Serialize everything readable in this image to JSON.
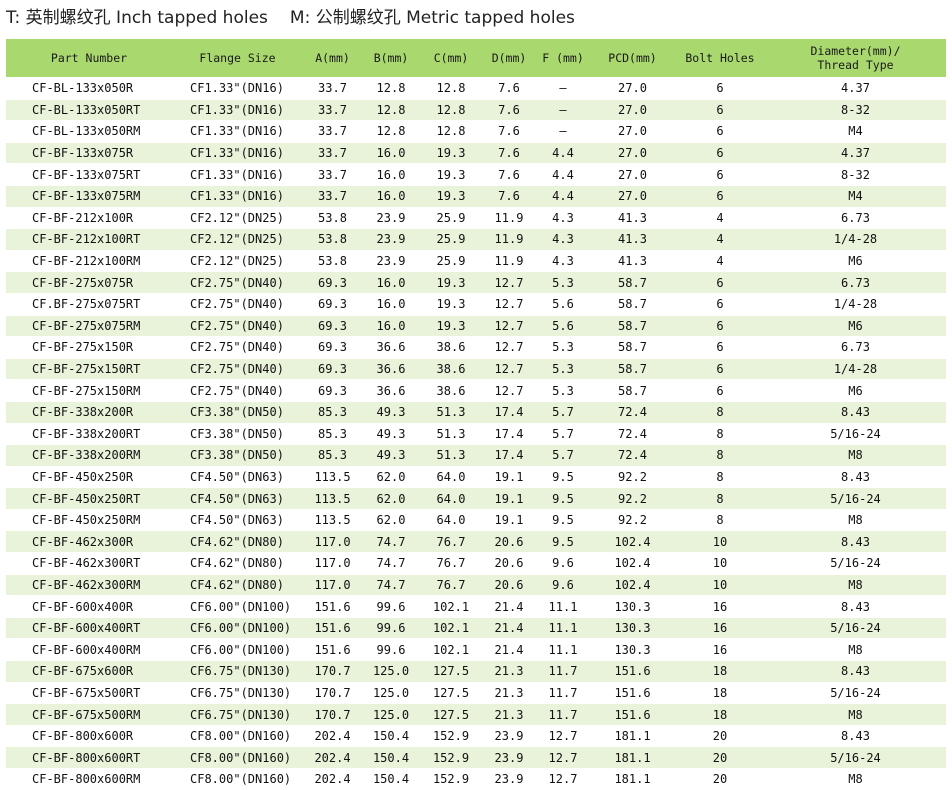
{
  "legend": {
    "inch": "T: 英制螺纹孔 Inch tapped holes",
    "metric": "M: 公制螺纹孔 Metric tapped holes"
  },
  "table": {
    "headers": [
      "Part Number",
      "Flange Size",
      "A(mm)",
      "B(mm)",
      "C(mm)",
      "D(mm)",
      "F (mm)",
      "PCD(mm)",
      "Bolt Holes",
      "Diameter(mm)/\nThread Type"
    ],
    "rows": [
      [
        "CF-BL-133x050R",
        "CF1.33\"(DN16)",
        "33.7",
        "12.8",
        "12.8",
        "7.6",
        "–",
        "27.0",
        "6",
        "4.37"
      ],
      [
        "CF-BL-133x050RT",
        "CF1.33\"(DN16)",
        "33.7",
        "12.8",
        "12.8",
        "7.6",
        "–",
        "27.0",
        "6",
        "8-32"
      ],
      [
        "CF-BL-133x050RM",
        "CF1.33\"(DN16)",
        "33.7",
        "12.8",
        "12.8",
        "7.6",
        "–",
        "27.0",
        "6",
        "M4"
      ],
      [
        "CF-BF-133x075R",
        "CF1.33\"(DN16)",
        "33.7",
        "16.0",
        "19.3",
        "7.6",
        "4.4",
        "27.0",
        "6",
        "4.37"
      ],
      [
        "CF-BF-133x075RT",
        "CF1.33\"(DN16)",
        "33.7",
        "16.0",
        "19.3",
        "7.6",
        "4.4",
        "27.0",
        "6",
        "8-32"
      ],
      [
        "CF-BF-133x075RM",
        "CF1.33\"(DN16)",
        "33.7",
        "16.0",
        "19.3",
        "7.6",
        "4.4",
        "27.0",
        "6",
        "M4"
      ],
      [
        "CF-BF-212x100R",
        "CF2.12\"(DN25)",
        "53.8",
        "23.9",
        "25.9",
        "11.9",
        "4.3",
        "41.3",
        "4",
        "6.73"
      ],
      [
        "CF-BF-212x100RT",
        "CF2.12\"(DN25)",
        "53.8",
        "23.9",
        "25.9",
        "11.9",
        "4.3",
        "41.3",
        "4",
        "1/4-28"
      ],
      [
        "CF-BF-212x100RM",
        "CF2.12\"(DN25)",
        "53.8",
        "23.9",
        "25.9",
        "11.9",
        "4.3",
        "41.3",
        "4",
        "M6"
      ],
      [
        "CF-BF-275x075R",
        "CF2.75\"(DN40)",
        "69.3",
        "16.0",
        "19.3",
        "12.7",
        "5.3",
        "58.7",
        "6",
        "6.73"
      ],
      [
        "CF.BF-275x075RT",
        "CF2.75\"(DN40)",
        "69.3",
        "16.0",
        "19.3",
        "12.7",
        "5.6",
        "58.7",
        "6",
        "1/4-28"
      ],
      [
        "CF-BF-275x075RM",
        "CF2.75\"(DN40)",
        "69.3",
        "16.0",
        "19.3",
        "12.7",
        "5.6",
        "58.7",
        "6",
        "M6"
      ],
      [
        "CF-BF-275x150R",
        "CF2.75\"(DN40)",
        "69.3",
        "36.6",
        "38.6",
        "12.7",
        "5.3",
        "58.7",
        "6",
        "6.73"
      ],
      [
        "CF-BF-275x150RT",
        "CF2.75\"(DN40)",
        "69.3",
        "36.6",
        "38.6",
        "12.7",
        "5.3",
        "58.7",
        "6",
        "1/4-28"
      ],
      [
        "CF-BF-275x150RM",
        "CF2.75\"(DN40)",
        "69.3",
        "36.6",
        "38.6",
        "12.7",
        "5.3",
        "58.7",
        "6",
        "M6"
      ],
      [
        "CF-BF-338x200R",
        "CF3.38\"(DN50)",
        "85.3",
        "49.3",
        "51.3",
        "17.4",
        "5.7",
        "72.4",
        "8",
        "8.43"
      ],
      [
        "CF-BF-338x200RT",
        "CF3.38\"(DN50)",
        "85.3",
        "49.3",
        "51.3",
        "17.4",
        "5.7",
        "72.4",
        "8",
        "5/16-24"
      ],
      [
        "CF-BF-338x200RM",
        "CF3.38\"(DN50)",
        "85.3",
        "49.3",
        "51.3",
        "17.4",
        "5.7",
        "72.4",
        "8",
        "M8"
      ],
      [
        "CF-BF-450x250R",
        "CF4.50\"(DN63)",
        "113.5",
        "62.0",
        "64.0",
        "19.1",
        "9.5",
        "92.2",
        "8",
        "8.43"
      ],
      [
        "CF-BF-450x250RT",
        "CF4.50\"(DN63)",
        "113.5",
        "62.0",
        "64.0",
        "19.1",
        "9.5",
        "92.2",
        "8",
        "5/16-24"
      ],
      [
        "CF-BF-450x250RM",
        "CF4.50\"(DN63)",
        "113.5",
        "62.0",
        "64.0",
        "19.1",
        "9.5",
        "92.2",
        "8",
        "M8"
      ],
      [
        "CF-BF-462x300R",
        "CF4.62\"(DN80)",
        "117.0",
        "74.7",
        "76.7",
        "20.6",
        "9.5",
        "102.4",
        "10",
        "8.43"
      ],
      [
        "CF-BF-462x300RT",
        "CF4.62\"(DN80)",
        "117.0",
        "74.7",
        "76.7",
        "20.6",
        "9.6",
        "102.4",
        "10",
        "5/16-24"
      ],
      [
        "CF-BF-462x300RM",
        "CF4.62\"(DN80)",
        "117.0",
        "74.7",
        "76.7",
        "20.6",
        "9.6",
        "102.4",
        "10",
        "M8"
      ],
      [
        "CF-BF-600x400R",
        "CF6.00\"(DN100)",
        "151.6",
        "99.6",
        "102.1",
        "21.4",
        "11.1",
        "130.3",
        "16",
        "8.43"
      ],
      [
        "CF-BF-600x400RT",
        "CF6.00\"(DN100)",
        "151.6",
        "99.6",
        "102.1",
        "21.4",
        "11.1",
        "130.3",
        "16",
        "5/16-24"
      ],
      [
        "CF-BF-600x400RM",
        "CF6.00\"(DN100)",
        "151.6",
        "99.6",
        "102.1",
        "21.4",
        "11.1",
        "130.3",
        "16",
        "M8"
      ],
      [
        "CF-BF-675x600R",
        "CF6.75\"(DN130)",
        "170.7",
        "125.0",
        "127.5",
        "21.3",
        "11.7",
        "151.6",
        "18",
        "8.43"
      ],
      [
        "CF-BF-675x500RT",
        "CF6.75\"(DN130)",
        "170.7",
        "125.0",
        "127.5",
        "21.3",
        "11.7",
        "151.6",
        "18",
        "5/16-24"
      ],
      [
        "CF-BF-675x500RM",
        "CF6.75\"(DN130)",
        "170.7",
        "125.0",
        "127.5",
        "21.3",
        "11.7",
        "151.6",
        "18",
        "M8"
      ],
      [
        "CF-BF-800x600R",
        "CF8.00\"(DN160)",
        "202.4",
        "150.4",
        "152.9",
        "23.9",
        "12.7",
        "181.1",
        "20",
        "8.43"
      ],
      [
        "CF-BF-800x600RT",
        "CF8.00\"(DN160)",
        "202.4",
        "150.4",
        "152.9",
        "23.9",
        "12.7",
        "181.1",
        "20",
        "5/16-24"
      ],
      [
        "CF-BF-800x600RM",
        "CF8.00\"(DN160)",
        "202.4",
        "150.4",
        "152.9",
        "23.9",
        "12.7",
        "181.1",
        "20",
        "M8"
      ]
    ]
  },
  "colors": {
    "header_bg": "#a9d86e",
    "stripe_bg": "#e9f3da"
  }
}
